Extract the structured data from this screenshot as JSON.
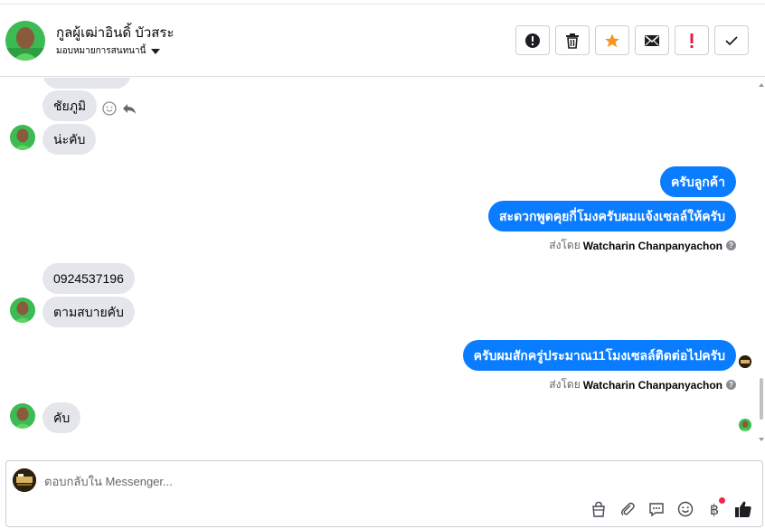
{
  "header": {
    "contact_name": "กูลผู้เฒ่าอินดิ้ บัวสระ",
    "assign_label": "มอบหมายการสนทนานี้",
    "actions": [
      {
        "name": "spam-button",
        "icon": "alert-circle-icon"
      },
      {
        "name": "delete-button",
        "icon": "trash-icon"
      },
      {
        "name": "star-button",
        "icon": "star-icon"
      },
      {
        "name": "mark-unread-button",
        "icon": "envelope-icon"
      },
      {
        "name": "follow-up-button",
        "icon": "exclamation-icon"
      },
      {
        "name": "mark-done-button",
        "icon": "check-icon"
      }
    ]
  },
  "messages": {
    "incoming_1": "ชัยภูมิ",
    "incoming_2": "น่ะคับ",
    "outgoing_1": "ครับลูกค้า",
    "outgoing_2": "สะดวกพูดคุยกี่โมงครับผมแจ้งเซลล์ให้ครับ",
    "sent_by_prefix": "ส่งโดย",
    "sent_by_name": "Watcharin Chanpanyachon",
    "incoming_3": "0924537196",
    "incoming_4": "ตามสบายคับ",
    "outgoing_3": "ครับผมสักครู่ประมาณ11โมงเซลล์ติดต่อไปครับ",
    "incoming_5": "คับ"
  },
  "composer": {
    "placeholder": "ตอบกลับใน Messenger...",
    "baht_symbol": "฿"
  },
  "colors": {
    "outgoing_bubble": "#0a7cff",
    "incoming_bubble": "#e4e6eb",
    "star": "#f7931e",
    "follow_up": "#e41e3f"
  }
}
